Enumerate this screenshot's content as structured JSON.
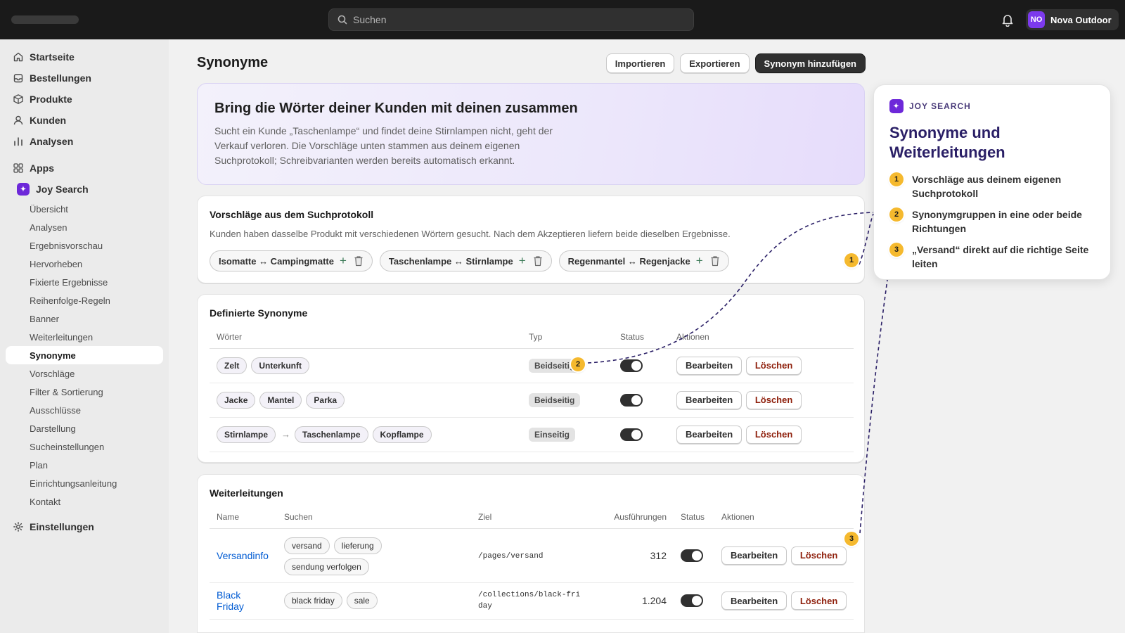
{
  "topbar": {
    "search_placeholder": "Suchen",
    "store_initials": "NO",
    "store_name": "Nova Outdoor"
  },
  "sidebar": {
    "main": [
      {
        "label": "Startseite",
        "icon": "home-icon"
      },
      {
        "label": "Bestellungen",
        "icon": "orders-icon"
      },
      {
        "label": "Produkte",
        "icon": "products-icon"
      },
      {
        "label": "Kunden",
        "icon": "customers-icon"
      },
      {
        "label": "Analysen",
        "icon": "analytics-icon"
      }
    ],
    "apps_label": "Apps",
    "app_name": "Joy Search",
    "app_items": [
      "Übersicht",
      "Analysen",
      "Ergebnisvorschau",
      "Hervorheben",
      "Fixierte Ergebnisse",
      "Reihenfolge-Regeln",
      "Banner",
      "Weiterleitungen",
      "Synonyme",
      "Vorschläge",
      "Filter & Sortierung",
      "Ausschlüsse",
      "Darstellung",
      "Sucheinstellungen",
      "Plan",
      "Einrichtungsanleitung",
      "Kontakt"
    ],
    "active_item": "Synonyme",
    "settings_label": "Einstellungen"
  },
  "page": {
    "title": "Synonyme",
    "import_label": "Importieren",
    "export_label": "Exportieren",
    "add_label": "Synonym hinzufügen"
  },
  "hero": {
    "title": "Bring die Wörter deiner Kunden mit deinen zusammen",
    "text": "Sucht ein Kunde „Taschenlampe“ und findet deine Stirnlampen nicht, geht der Verkauf verloren. Die Vorschläge unten stammen aus deinem eigenen Suchprotokoll; Schreibvarianten werden bereits automatisch erkannt."
  },
  "suggestions": {
    "title": "Vorschläge aus dem Suchprotokoll",
    "description": "Kunden haben dasselbe Produkt mit verschiedenen Wörtern gesucht. Nach dem Akzeptieren liefern beide dieselben Ergebnisse.",
    "items": [
      "Isomatte ↔ Campingmatte",
      "Taschenlampe ↔ Stirnlampe",
      "Regenmantel ↔ Regenjacke"
    ]
  },
  "synonyms": {
    "title": "Definierte Synonyme",
    "columns": [
      "Wörter",
      "Typ",
      "Status",
      "Aktionen"
    ],
    "rows": [
      {
        "words": [
          "Zelt",
          "Unterkunft"
        ],
        "source": null,
        "type": "Beidseitig",
        "active": true
      },
      {
        "words": [
          "Jacke",
          "Mantel",
          "Parka"
        ],
        "source": null,
        "type": "Beidseitig",
        "active": true
      },
      {
        "words": [
          "Taschenlampe",
          "Kopflampe"
        ],
        "source": "Stirnlampe",
        "type": "Einseitig",
        "active": true
      }
    ],
    "edit_label": "Bearbeiten",
    "delete_label": "Löschen"
  },
  "redirects": {
    "title": "Weiterleitungen",
    "columns": [
      "Name",
      "Suchen",
      "Ziel",
      "Ausführungen",
      "Status",
      "Aktionen"
    ],
    "rows": [
      {
        "name": "Versandinfo",
        "terms": [
          "versand",
          "lieferung",
          "sendung verfolgen"
        ],
        "target": "/pages/versand",
        "count": "312",
        "active": true
      },
      {
        "name": "Black Friday",
        "terms": [
          "black friday",
          "sale"
        ],
        "target": "/collections/black-friday",
        "count": "1.204",
        "active": true
      }
    ],
    "edit_label": "Bearbeiten",
    "delete_label": "Löschen"
  },
  "callout": {
    "kicker": "JOY SEARCH",
    "title": "Synonyme und Weiterleitungen",
    "points": [
      {
        "n": "1",
        "text": "Vorschläge aus deinem eigenen Suchprotokoll"
      },
      {
        "n": "2",
        "text": "Synonymgruppen in eine oder beide Richtungen"
      },
      {
        "n": "3",
        "text": "„Versand“ direkt auf die richtige Seite leiten"
      }
    ]
  },
  "colors": {
    "topbar": "#1a1a1a",
    "accent": "#7c3aed",
    "marker": "#f5b92e",
    "callout_title": "#2a1f66",
    "link": "#005bd3",
    "delete": "#8e1f0b"
  }
}
